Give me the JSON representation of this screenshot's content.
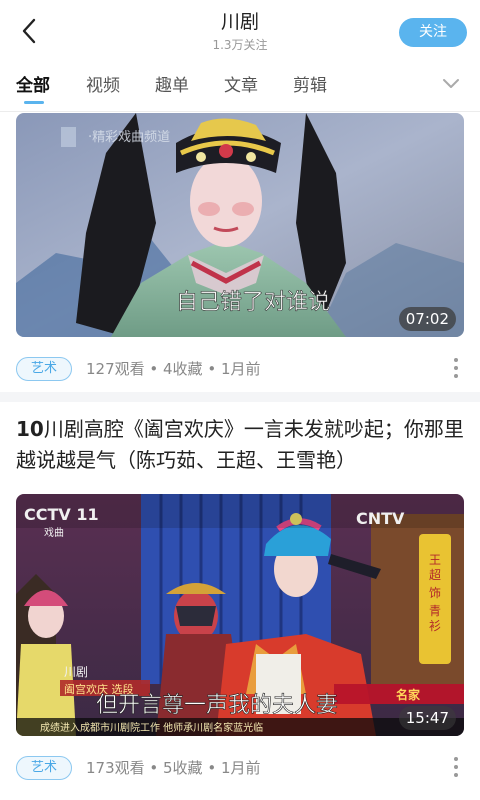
{
  "header": {
    "title": "川剧",
    "followers": "1.3万关注",
    "follow_label": "关注"
  },
  "tabs": [
    {
      "label": "全部",
      "active": true
    },
    {
      "label": "视频",
      "active": false
    },
    {
      "label": "趣单",
      "active": false
    },
    {
      "label": "文章",
      "active": false
    },
    {
      "label": "剪辑",
      "active": false
    }
  ],
  "cards": [
    {
      "subtitle": "自己错了对谁说",
      "duration": "07:02",
      "tag": "艺术",
      "stats": "127观看 • 4收藏 • 1月前"
    },
    {
      "index": "10",
      "title": "川剧高腔《阖宫欢庆》一言未发就吵起；你那里越说越是气（陈巧茹、王超、王雪艳）",
      "subtitle": "但开言尊一声我的夫人妻",
      "caption": "成绩进入成都市川剧院工作 他师承川剧名家蓝光临",
      "channel_left": "CCTV 11",
      "channel_left_sub": "戏曲",
      "channel_right": "CNTV",
      "program_top": "川剧",
      "program": "阖宫欢庆 选段",
      "side_label": "王超 饰 青衫",
      "corner": "名家",
      "duration": "15:47",
      "tag": "艺术",
      "stats": "173观看 • 5收藏 • 1月前"
    }
  ],
  "colors": {
    "accent": "#5ab4ee",
    "tag_border": "#8cc8f0",
    "divider": "#f4f5f7"
  }
}
